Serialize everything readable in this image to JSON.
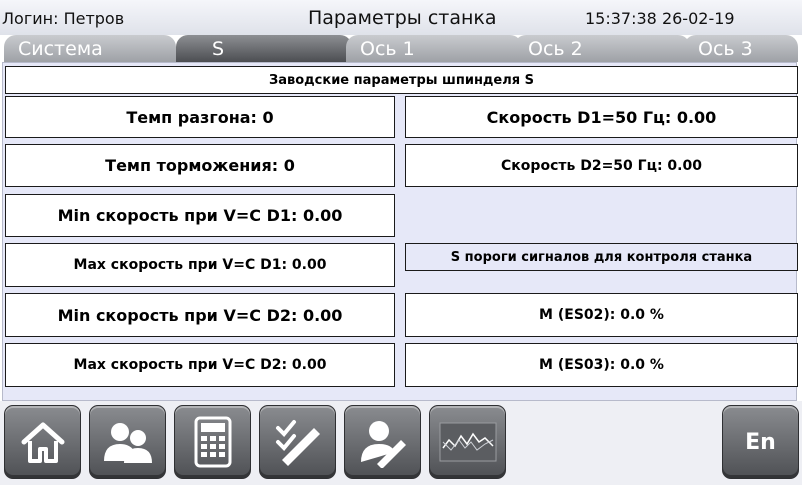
{
  "header": {
    "login": "Логин: Петров",
    "title": "Параметры станка",
    "datetime": "15:37:38 26-02-19"
  },
  "tabs": [
    {
      "label": "Система",
      "active": false
    },
    {
      "label": "S",
      "active": true
    },
    {
      "label": "Ось 1",
      "active": false
    },
    {
      "label": "Ось 2",
      "active": false
    },
    {
      "label": "Ось 3",
      "active": false
    }
  ],
  "panel": {
    "title": "Заводские параметры шпинделя S",
    "left": [
      "Темп разгона: 0",
      "Темп торможения: 0",
      "Min скорость при V=C D1: 0.00",
      "Max скорость при V=C D1: 0.00",
      "Min скорость при V=C D2: 0.00",
      "Max скорость при V=C D2: 0.00"
    ],
    "right": {
      "speed_d1": "Скорость D1=50 Гц: 0.00",
      "speed_d2": "Скорость D2=50 Гц: 0.00",
      "thresholds_title": "S пороги сигналов для контроля станка",
      "m_es02": "M (ES02): 0.0 %",
      "m_es03": "M (ES03): 0.0 %"
    }
  },
  "toolbar": {
    "icons": [
      "home-icon",
      "users-icon",
      "calculator-icon",
      "checklist-pen-icon",
      "user-edit-icon",
      "graph-icon"
    ],
    "lang_label": "En"
  },
  "colors": {
    "panel_bg": "#e6e8f8",
    "tab_active": "#4c4e52",
    "tab_inactive": "#9ea1a6",
    "button_gray": "#6c6e72"
  }
}
